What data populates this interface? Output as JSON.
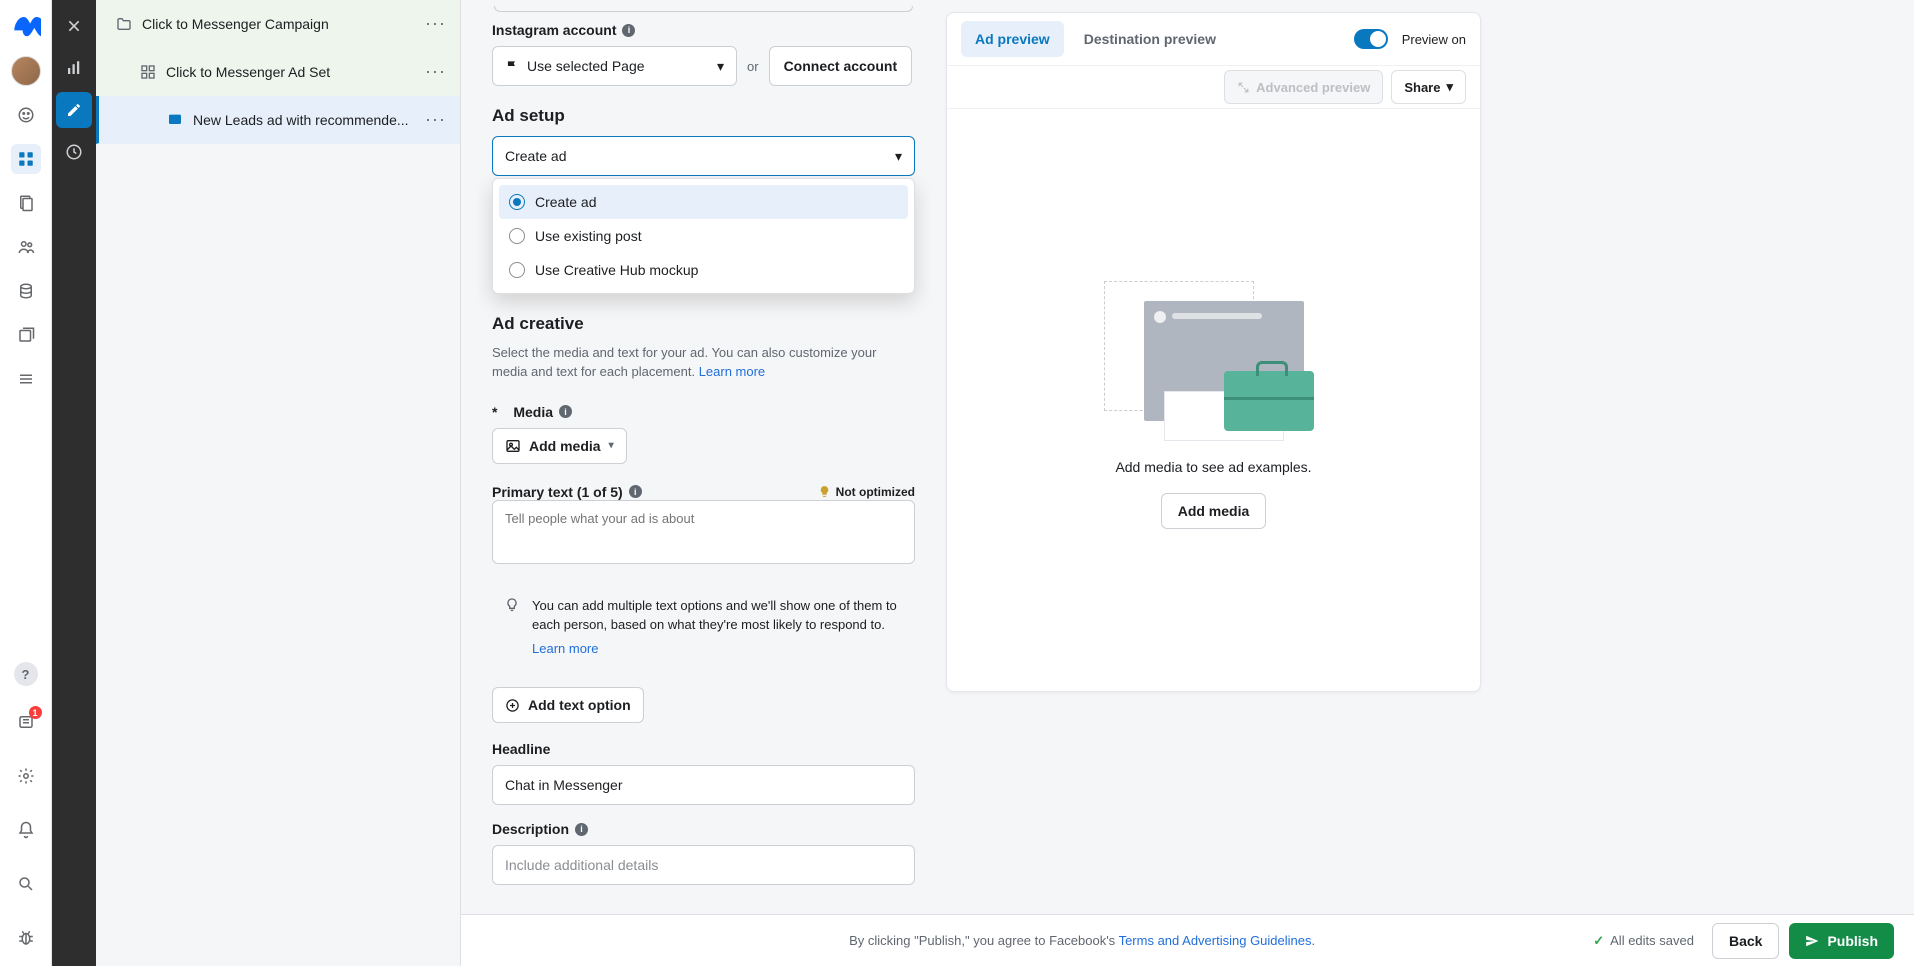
{
  "tree": {
    "campaign": "Click to Messenger Campaign",
    "adset": "Click to Messenger Ad Set",
    "ad": "New Leads ad with recommende..."
  },
  "instagram": {
    "label": "Instagram account",
    "use_selected": "Use selected Page",
    "or": "or",
    "connect": "Connect account"
  },
  "ad_setup": {
    "title": "Ad setup",
    "selected": "Create ad",
    "options": {
      "create": "Create ad",
      "existing": "Use existing post",
      "mockup": "Use Creative Hub mockup"
    }
  },
  "ad_creative": {
    "title": "Ad creative",
    "desc": "Select the media and text for your ad. You can also customize your media and text for each placement. ",
    "learn_more": "Learn more"
  },
  "media": {
    "label_prefix": "*",
    "label": "Media",
    "add": "Add media"
  },
  "primary_text": {
    "label": "Primary text (1 of 5)",
    "not_optimized": "Not optimized",
    "placeholder": "Tell people what your ad is about",
    "tip": "You can add multiple text options and we'll show one of them to each person, based on what they're most likely to respond to.",
    "tip_learn_more": "Learn more",
    "add_option": "Add text option"
  },
  "headline": {
    "label": "Headline",
    "value": "Chat in Messenger"
  },
  "description": {
    "label": "Description",
    "placeholder": "Include additional details"
  },
  "preview": {
    "tabs": {
      "ad": "Ad preview",
      "dest": "Destination preview"
    },
    "toggle_label": "Preview on",
    "advanced": "Advanced preview",
    "share": "Share",
    "empty_msg": "Add media to see ad examples.",
    "cta": "Add media"
  },
  "footer": {
    "agree_pre": "By clicking \"Publish,\" you agree to Facebook's ",
    "agree_link": "Terms and Advertising Guidelines",
    "agree_post": ".",
    "saved": "All edits saved",
    "back": "Back",
    "publish": "Publish"
  },
  "badges": {
    "news": "1"
  },
  "help_glyph": "?"
}
